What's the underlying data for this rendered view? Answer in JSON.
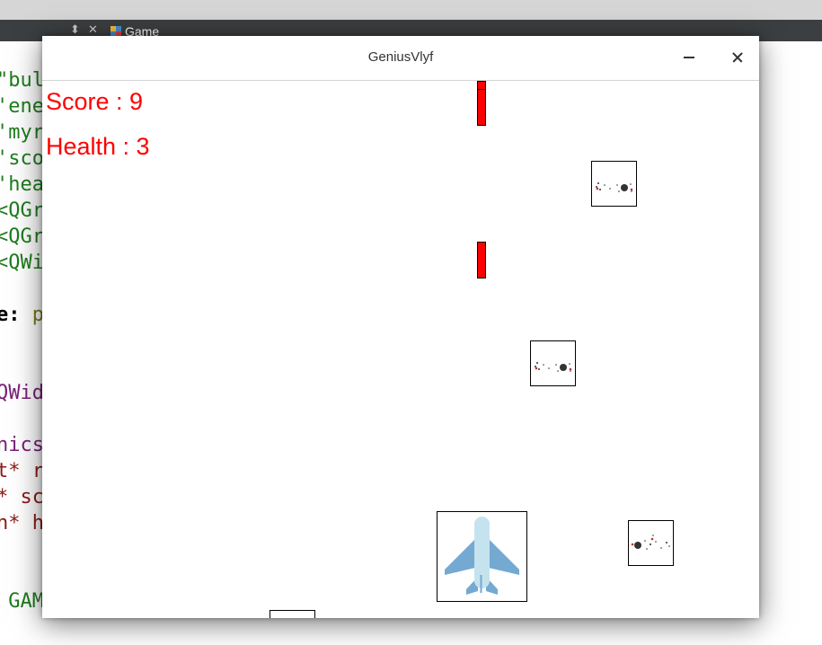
{
  "ide": {
    "tab_label": "Game",
    "code_lines": [
      {
        "text": "\"bul",
        "color": "green"
      },
      {
        "text": "'ene",
        "color": "green"
      },
      {
        "text": "'myr",
        "color": "green"
      },
      {
        "text": "'sco",
        "color": "green"
      },
      {
        "text": "'hea",
        "color": "green"
      },
      {
        "text": "<QGr",
        "color": "green"
      },
      {
        "text": "<QGr",
        "color": "green"
      },
      {
        "text": "<QWi",
        "color": "green"
      },
      {
        "text": "",
        "color": "green"
      },
      {
        "text": "e:",
        "color": "black",
        "suffix": " p"
      },
      {
        "text": "",
        "color": "green"
      },
      {
        "text": "",
        "color": "green"
      },
      {
        "text": "QWid",
        "color": "purple"
      },
      {
        "text": "",
        "color": "green"
      },
      {
        "text": "nics",
        "color": "purple"
      },
      {
        "text": "t* r",
        "color": "red"
      },
      {
        "text": "* sc",
        "color": "red"
      },
      {
        "text": "n* h",
        "color": "red"
      },
      {
        "text": "",
        "color": "green"
      },
      {
        "text": "",
        "color": "green"
      },
      {
        "text": " GAM",
        "color": "green"
      }
    ]
  },
  "window": {
    "title": "GeniusVlyf",
    "controls": {
      "minimize": "minimize-icon",
      "close": "close-icon"
    }
  },
  "game": {
    "score_label": "Score : 9",
    "health_label": "Health : 3",
    "score": 9,
    "health": 3,
    "colors": {
      "hud": "#ff0000",
      "bullet": "#ff0000",
      "plane_body": "#c5e3ef",
      "plane_wings": "#74a9d2"
    }
  }
}
